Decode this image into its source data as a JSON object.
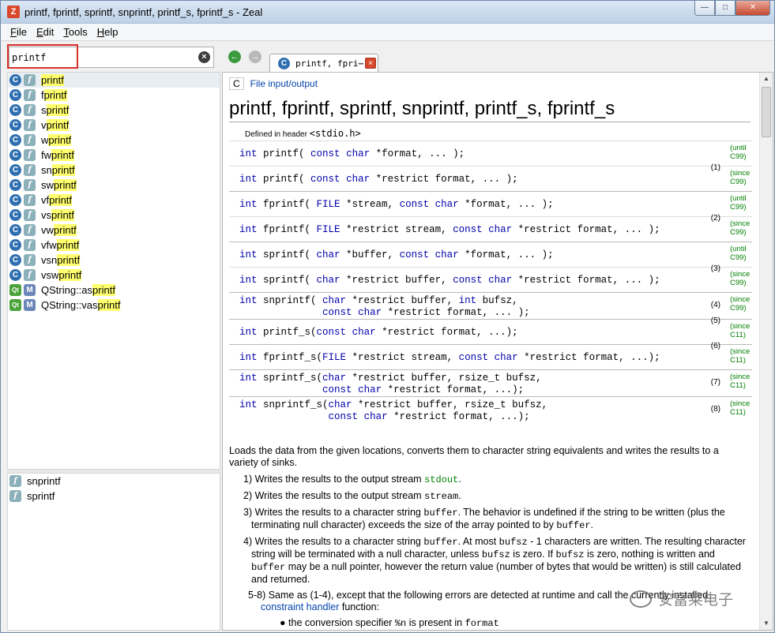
{
  "window": {
    "title": "printf, fprintf, sprintf, snprintf, printf_s, fprintf_s - Zeal",
    "app_icon": "Z",
    "controls": [
      "minimize-icon",
      "maximize-icon",
      "close-icon"
    ]
  },
  "menu": [
    {
      "label": "File",
      "underline": "F",
      "rest": "ile"
    },
    {
      "label": "Edit",
      "underline": "E",
      "rest": "dit"
    },
    {
      "label": "Tools",
      "underline": "T",
      "rest": "ools"
    },
    {
      "label": "Help",
      "underline": "H",
      "rest": "elp"
    }
  ],
  "search": {
    "value": "printf",
    "placeholder": ""
  },
  "results": [
    {
      "docset": "C",
      "type": "f",
      "pre": "",
      "hl": "printf",
      "post": "",
      "selected": true
    },
    {
      "docset": "C",
      "type": "f",
      "pre": "f",
      "hl": "printf",
      "post": ""
    },
    {
      "docset": "C",
      "type": "f",
      "pre": "s",
      "hl": "printf",
      "post": ""
    },
    {
      "docset": "C",
      "type": "f",
      "pre": "v",
      "hl": "printf",
      "post": ""
    },
    {
      "docset": "C",
      "type": "f",
      "pre": "w",
      "hl": "printf",
      "post": ""
    },
    {
      "docset": "C",
      "type": "f",
      "pre": "fw",
      "hl": "printf",
      "post": ""
    },
    {
      "docset": "C",
      "type": "f",
      "pre": "sn",
      "hl": "printf",
      "post": ""
    },
    {
      "docset": "C",
      "type": "f",
      "pre": "sw",
      "hl": "printf",
      "post": ""
    },
    {
      "docset": "C",
      "type": "f",
      "pre": "vf",
      "hl": "printf",
      "post": ""
    },
    {
      "docset": "C",
      "type": "f",
      "pre": "vs",
      "hl": "printf",
      "post": ""
    },
    {
      "docset": "C",
      "type": "f",
      "pre": "vw",
      "hl": "printf",
      "post": ""
    },
    {
      "docset": "C",
      "type": "f",
      "pre": "vfw",
      "hl": "printf",
      "post": ""
    },
    {
      "docset": "C",
      "type": "f",
      "pre": "vsn",
      "hl": "printf",
      "post": ""
    },
    {
      "docset": "C",
      "type": "f",
      "pre": "vsw",
      "hl": "printf",
      "post": ""
    },
    {
      "docset": "Qt",
      "type": "M",
      "pre": "QString::as",
      "hl": "printf",
      "post": ""
    },
    {
      "docset": "Qt",
      "type": "M",
      "pre": "QString::vas",
      "hl": "printf",
      "post": ""
    }
  ],
  "related": [
    "snprintf",
    "sprintf"
  ],
  "toolbar": {
    "back": "back-icon",
    "forward": "forward-icon"
  },
  "tab": {
    "label": "printf, fpri⋯",
    "docset": "C"
  },
  "doc": {
    "breadcrumb_c": "C",
    "breadcrumb_link": "File input/output",
    "title": "printf, fprintf, sprintf, snprintf, printf_s, fprintf_s",
    "defined_prefix": "Defined in header ",
    "defined_header": "<stdio.h>",
    "declarations": [
      {
        "lines": [
          "int printf( const char *format, ... );"
        ],
        "num": "",
        "ver": [
          "(until",
          "C99)"
        ]
      },
      {
        "lines": [
          "int printf( const char *restrict format, ... );"
        ],
        "num": "(1)",
        "ver": [
          "(since",
          "C99)"
        ]
      },
      {
        "lines": [
          "int fprintf( FILE *stream, const char *format, ... );"
        ],
        "num": "",
        "ver": [
          "(until",
          "C99)"
        ],
        "group_start": true
      },
      {
        "lines": [
          "int fprintf( FILE *restrict stream, const char *restrict format, ... );"
        ],
        "num": "(2)",
        "ver": [
          "(since",
          "C99)"
        ]
      },
      {
        "lines": [
          "int sprintf( char *buffer, const char *format, ... );"
        ],
        "num": "",
        "ver": [
          "(until",
          "C99)"
        ],
        "group_start": true
      },
      {
        "lines": [
          "int sprintf( char *restrict buffer, const char *restrict format, ... );"
        ],
        "num": "(3)",
        "ver": [
          "(since",
          "C99)"
        ]
      },
      {
        "lines": [
          "int snprintf( char *restrict buffer, int bufsz,",
          "              const char *restrict format, ... );"
        ],
        "num": "(4)",
        "ver": [
          "(since",
          "C99)"
        ],
        "group_start": true
      },
      {
        "lines": [
          "int printf_s(const char *restrict format, ...);"
        ],
        "num": "(5)",
        "ver": [
          "(since",
          "C11)"
        ],
        "group_start": true
      },
      {
        "lines": [
          "int fprintf_s(FILE *restrict stream, const char *restrict format, ...);"
        ],
        "num": "(6)",
        "ver": [
          "(since",
          "C11)"
        ],
        "group_start": true
      },
      {
        "lines": [
          "int sprintf_s(char *restrict buffer, rsize_t bufsz,",
          "              const char *restrict format, ...);"
        ],
        "num": "(7)",
        "ver": [
          "(since",
          "C11)"
        ],
        "group_start": true
      },
      {
        "lines": [
          "int snprintf_s(char *restrict buffer, rsize_t bufsz,",
          "               const char *restrict format, ...);"
        ],
        "num": "(8)",
        "ver": [
          "(since",
          "C11)"
        ],
        "group_start": true
      }
    ],
    "intro": "Loads the data from the given locations, converts them to character string equivalents and writes the results to a variety of sinks.",
    "items": [
      {
        "n": "1)",
        "parts": [
          [
            "t",
            "Writes the results to the output stream "
          ],
          [
            "g",
            "stdout"
          ],
          [
            "t",
            "."
          ]
        ]
      },
      {
        "n": "2)",
        "parts": [
          [
            "t",
            "Writes the results to the output stream "
          ],
          [
            "m",
            "stream"
          ],
          [
            "t",
            "."
          ]
        ]
      },
      {
        "n": "3)",
        "parts": [
          [
            "t",
            "Writes the results to a character string "
          ],
          [
            "m",
            "buffer"
          ],
          [
            "t",
            ". The behavior is undefined if the string to be written (plus the terminating null character) exceeds the size of the array pointed to by "
          ],
          [
            "m",
            "buffer"
          ],
          [
            "t",
            "."
          ]
        ]
      },
      {
        "n": "4)",
        "parts": [
          [
            "t",
            "Writes the results to a character string "
          ],
          [
            "m",
            "buffer"
          ],
          [
            "t",
            ". At most "
          ],
          [
            "m",
            "bufsz"
          ],
          [
            "t",
            " - 1 characters are written. The resulting character string will be terminated with a null character, unless "
          ],
          [
            "m",
            "bufsz"
          ],
          [
            "t",
            " is zero. If "
          ],
          [
            "m",
            "bufsz"
          ],
          [
            "t",
            " is zero, nothing is written and "
          ],
          [
            "m",
            "buffer"
          ],
          [
            "t",
            " may be a null pointer, however the return value (number of bytes that would be written) is still calculated and returned."
          ]
        ]
      },
      {
        "n": "5-8)",
        "parts": [
          [
            "t",
            "Same as (1-4), except that the following errors are detected at runtime and call the currently installed "
          ],
          [
            "l",
            "constraint handler"
          ],
          [
            "t",
            " function:"
          ]
        ]
      }
    ],
    "bullet": [
      [
        "t",
        "the conversion specifier "
      ],
      [
        "m",
        "%n"
      ],
      [
        "t",
        " is present in "
      ],
      [
        "m",
        "format"
      ]
    ]
  },
  "watermark": "安富莱电子",
  "colors": {
    "accent_green": "#008000",
    "keyword_blue": "#0000aa",
    "link": "#0645ad",
    "highlight": "#ffff6e",
    "search_box_outline": "#d9302a"
  }
}
